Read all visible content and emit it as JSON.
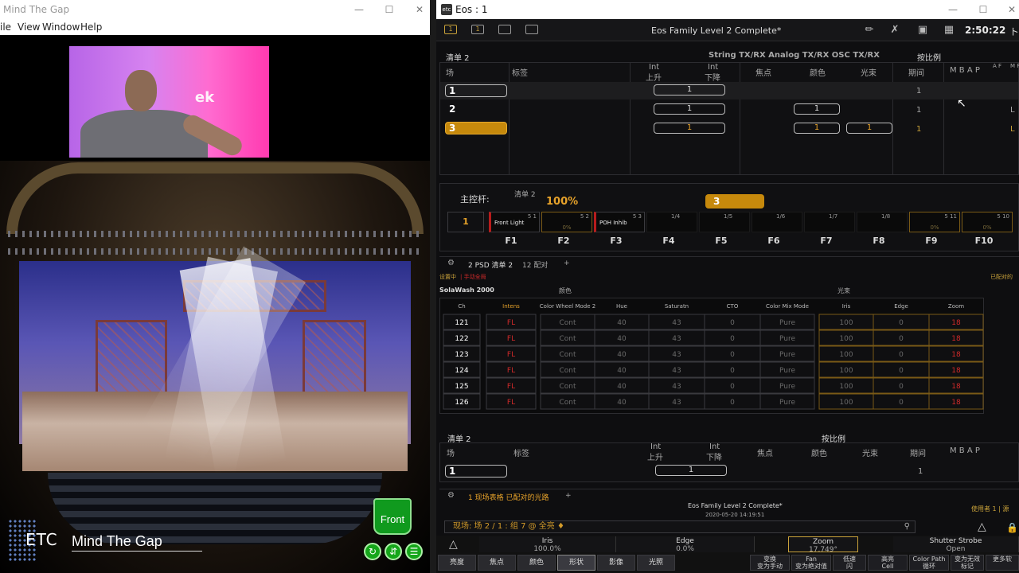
{
  "left_window": {
    "title": "Mind The Gap",
    "menu": [
      "ile",
      "View",
      "Window",
      "Help"
    ],
    "webcam_logo": "ek",
    "branding": {
      "logo": "ETC",
      "title": "Mind The Gap"
    },
    "front_button": "Front",
    "round_buttons": [
      "refresh-icon",
      "swap-icon",
      "menu-icon"
    ]
  },
  "eos": {
    "window_title": "Eos : 1",
    "show_name": "Eos Family Level 2 Complete*",
    "clock": "2:50:22",
    "clock_suffix": "ト",
    "cue_list_top": {
      "title": "清单 2",
      "protocols": "String TX/RX  Analog TX/RX  OSC TX/RX",
      "mode": "按比例",
      "columns": {
        "cue": "场",
        "label": "标签",
        "int_up_1": "Int",
        "int_up_2": "上升",
        "int_down_1": "Int",
        "int_down_2": "下降",
        "focus": "焦点",
        "color": "颜色",
        "beam": "光束",
        "duration": "期间",
        "flags": "M B A P",
        "af": "A F",
        "mf": "M F"
      },
      "rows": [
        {
          "cue": "1",
          "up": "1",
          "color": "",
          "beam": "",
          "dur": "1",
          "flag": ""
        },
        {
          "cue": "2",
          "up": "1",
          "color": "1",
          "beam": "",
          "dur": "1",
          "flag": "L"
        },
        {
          "cue": "3",
          "up": "1",
          "color": "1",
          "beam": "1",
          "dur": "1",
          "flag": "L"
        }
      ]
    },
    "master": {
      "label": "主控杆:",
      "list": "清单 2",
      "percent": "100%",
      "cue_badge": "3",
      "fader_index": "1",
      "faders": [
        {
          "num": "5 1",
          "name": "Front Light",
          "pct": ""
        },
        {
          "num": "5 2",
          "name": "",
          "pct": "0%"
        },
        {
          "num": "5 3",
          "name": "POH Inhib",
          "pct": ""
        },
        {
          "num": "1/4",
          "name": "",
          "pct": ""
        },
        {
          "num": "1/5",
          "name": "",
          "pct": ""
        },
        {
          "num": "1/6",
          "name": "",
          "pct": ""
        },
        {
          "num": "1/7",
          "name": "",
          "pct": ""
        },
        {
          "num": "1/8",
          "name": "",
          "pct": ""
        },
        {
          "num": "5 11",
          "name": "",
          "pct": "0%"
        },
        {
          "num": "5 10",
          "name": "",
          "pct": "0%"
        }
      ],
      "fkeys": [
        "F1",
        "F2",
        "F3",
        "F4",
        "F5",
        "F6",
        "F7",
        "F8",
        "F9",
        "F10"
      ]
    },
    "tabs_top": [
      "2 PSD 清单 2",
      "12 配对",
      "+"
    ],
    "spreadsheet": {
      "status_left": "设置中",
      "status_red": "| 手动全局",
      "status_right": "已配对的",
      "fixture": "SolaWash 2000",
      "group_color": "颜色",
      "group_beam": "光束",
      "headers": [
        "Ch",
        "Intens",
        "Color Wheel Mode 2",
        "Hue",
        "Saturatn",
        "CTO",
        "Color Mix Mode",
        "Iris",
        "Edge",
        "Zoom"
      ],
      "rows": [
        [
          "121",
          "FL",
          "Cont",
          "40",
          "43",
          "0",
          "Pure",
          "100",
          "0",
          "18"
        ],
        [
          "122",
          "FL",
          "Cont",
          "40",
          "43",
          "0",
          "Pure",
          "100",
          "0",
          "18"
        ],
        [
          "123",
          "FL",
          "Cont",
          "40",
          "43",
          "0",
          "Pure",
          "100",
          "0",
          "18"
        ],
        [
          "124",
          "FL",
          "Cont",
          "40",
          "43",
          "0",
          "Pure",
          "100",
          "0",
          "18"
        ],
        [
          "125",
          "FL",
          "Cont",
          "40",
          "43",
          "0",
          "Pure",
          "100",
          "0",
          "18"
        ],
        [
          "126",
          "FL",
          "Cont",
          "40",
          "43",
          "0",
          "Pure",
          "100",
          "0",
          "18"
        ]
      ]
    },
    "cue_list_bottom": {
      "title": "清单 2",
      "mode": "按比例",
      "columns": {
        "cue": "场",
        "label": "标签",
        "int_up_1": "Int",
        "int_up_2": "上升",
        "int_down_1": "Int",
        "int_down_2": "下降",
        "focus": "焦点",
        "color": "颜色",
        "beam": "光束",
        "duration": "期间",
        "flags": "M B A P"
      },
      "row": {
        "cue": "1",
        "up": "1",
        "dur": "1"
      }
    },
    "tabs_bottom": [
      "1 现场表格 已配对的光路",
      "+"
    ],
    "bottom_show_name": "Eos Family Level 2 Complete*",
    "bottom_date": "2020-05-20 14:19:51",
    "user": "使用者 1 | 源",
    "command_line": "现场: 场  2 / 1 : 组  7 @ 全亮 ♦",
    "encoders": [
      {
        "name": "Iris",
        "value": "100.0%"
      },
      {
        "name": "Edge",
        "value": "0.0%"
      },
      {
        "name": "Zoom",
        "value": "17.749°"
      },
      {
        "name": "Shutter Strobe",
        "value": "Open"
      }
    ],
    "category_buttons": [
      "亮度",
      "焦点",
      "颜色",
      "形状",
      "影像",
      "光照"
    ],
    "softkeys": [
      {
        "top": "变换",
        "bottom": "变为手动"
      },
      {
        "top": "Fan",
        "bottom": "变为绝对值"
      },
      {
        "top": "低速",
        "bottom": "闪"
      },
      {
        "top": "高亮",
        "bottom": "Cell"
      },
      {
        "top": "Color Path",
        "bottom": "循环"
      },
      {
        "top": "变为无效",
        "bottom": "标记"
      },
      {
        "top": "",
        "bottom": "更多软"
      }
    ]
  }
}
